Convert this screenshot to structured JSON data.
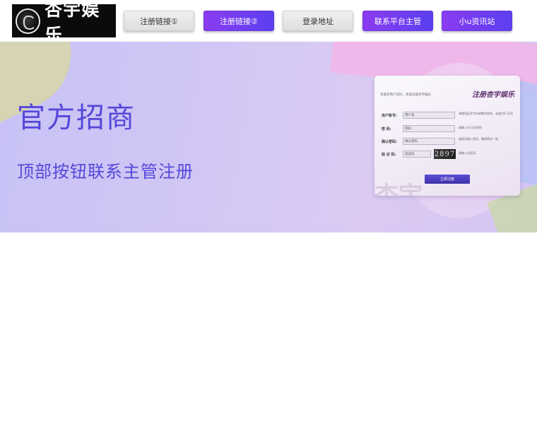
{
  "header": {
    "logo_text": "杏宇娱乐",
    "nav": [
      {
        "label": "注册链接①",
        "style": "grey"
      },
      {
        "label": "注册链接②",
        "style": "purple"
      },
      {
        "label": "登录地址",
        "style": "grey"
      },
      {
        "label": "联系平台主管",
        "style": "purple"
      },
      {
        "label": "小u资讯站",
        "style": "purple"
      }
    ]
  },
  "hero": {
    "title": "官方招商",
    "subtitle": "顶部按钮联系主管注册",
    "card": {
      "notice": "亲爱的用户您好，欢迎注册杏宇娱乐",
      "brand": "注册杏宇娱乐",
      "fields": [
        {
          "label": "用户账号:",
          "value": "用户名",
          "hint": "请使用英文字母或数字组合，长度为6-12位"
        },
        {
          "label": "密  码:",
          "value": "密码",
          "hint": "请输入6-12位密码"
        },
        {
          "label": "确认密码:",
          "value": "确认密码",
          "hint": "请再次输入密码，确保两次一致"
        },
        {
          "label": "验 证 码:",
          "value": "验证码",
          "hint": "请输入验证码"
        }
      ],
      "captcha": "2897",
      "submit": "立即注册",
      "watermark": "杏宇"
    }
  },
  "colors": {
    "accent_purple": "#7a3ff0",
    "title_blue": "#5548d9"
  }
}
